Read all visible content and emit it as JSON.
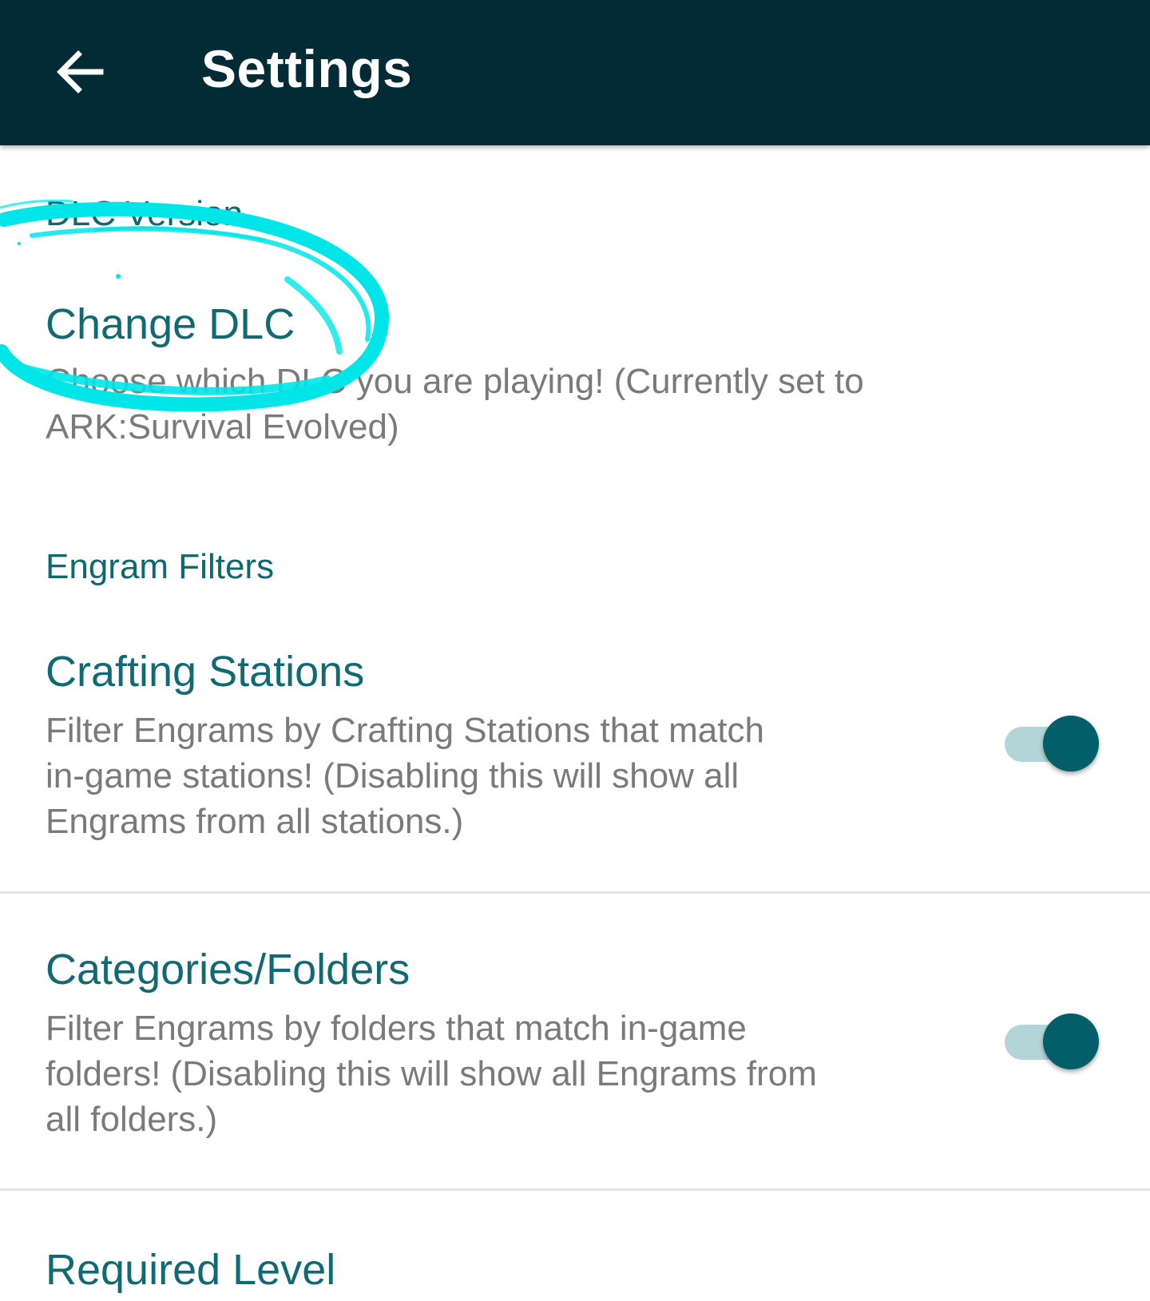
{
  "appbar": {
    "title": "Settings",
    "back_icon": "arrow-back-icon",
    "background_color": "#022b36"
  },
  "sections": {
    "dlc": {
      "header": "DLC Version",
      "change_dlc": {
        "title": "Change DLC",
        "summary_line1": "Choose which DLC you are playing! (Currently set to",
        "summary_line2": "ARK:Survival Evolved)"
      }
    },
    "engram_filters": {
      "header": "Engram Filters",
      "crafting_stations": {
        "title": "Crafting Stations",
        "summary_line1": "Filter Engrams by Crafting Stations that match",
        "summary_line2": "in-game stations! (Disabling this will show all",
        "summary_line3": "Engrams from all stations.)",
        "enabled": true
      },
      "categories_folders": {
        "title": "Categories/Folders",
        "summary_line1": "Filter Engrams by folders that match in-game",
        "summary_line2": "folders! (Disabling this will show all Engrams from",
        "summary_line3": "all folders.)",
        "enabled": true
      },
      "required_level": {
        "title": "Required Level"
      }
    }
  },
  "colors": {
    "accent": "#0f6a73",
    "switch_thumb": "#025f69",
    "switch_track": "#b4d5d7",
    "summary_text": "#7a7a7a",
    "annotation_marker": "#00e5e8"
  }
}
